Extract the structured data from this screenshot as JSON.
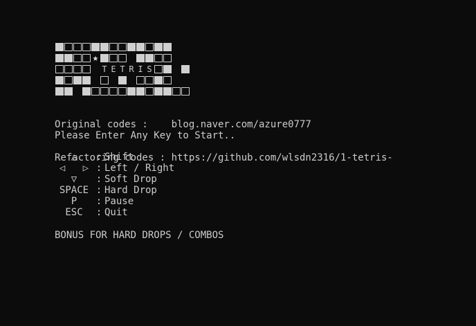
{
  "logo": {
    "rows": [
      [
        "f",
        "e",
        "e",
        "e",
        "f",
        "f",
        "e",
        "e",
        "f",
        "f",
        "e",
        "f",
        "f"
      ],
      [
        "f",
        "f",
        "e",
        "e",
        "*",
        "f",
        "e",
        "e",
        "b",
        "f",
        "f",
        "e",
        "e"
      ],
      [
        "e",
        "e",
        "e",
        "e",
        "b",
        "T",
        "E",
        "T",
        "R",
        "I",
        "S",
        "e",
        "f",
        "b",
        "f"
      ],
      [
        "f",
        "e",
        "f",
        "f",
        "b",
        "e",
        "b",
        "f",
        "b",
        "e",
        "e",
        "f",
        "e"
      ],
      [
        "f",
        "f",
        "b",
        "f",
        "e",
        "e",
        "e",
        "e",
        "f",
        "f",
        "e",
        "f",
        "f",
        "e",
        "e"
      ]
    ]
  },
  "credits": {
    "original": "Original codes :    blog.naver.com/azure0777",
    "refactoring": "Refactoring codes : https://github.com/wlsdn2316/1-tetris-"
  },
  "prompt": "Please Enter Any Key to Start..",
  "controls": [
    {
      "key": "△",
      "desc": "Shift",
      "icon": "up-triangle-icon"
    },
    {
      "key": "◁   ▷",
      "desc": "Left / Right",
      "icon": "left-right-triangle-icon"
    },
    {
      "key": "▽",
      "desc": "Soft Drop",
      "icon": "down-triangle-icon"
    },
    {
      "key": "SPACE",
      "desc": "Hard Drop",
      "icon": ""
    },
    {
      "key": "P",
      "desc": "Pause",
      "icon": ""
    },
    {
      "key": "ESC",
      "desc": "Quit",
      "icon": ""
    }
  ],
  "separator": ":",
  "bonus": "BONUS FOR HARD DROPS / COMBOS",
  "colors": {
    "background": "#0c0c0c",
    "text": "#cccccc"
  }
}
